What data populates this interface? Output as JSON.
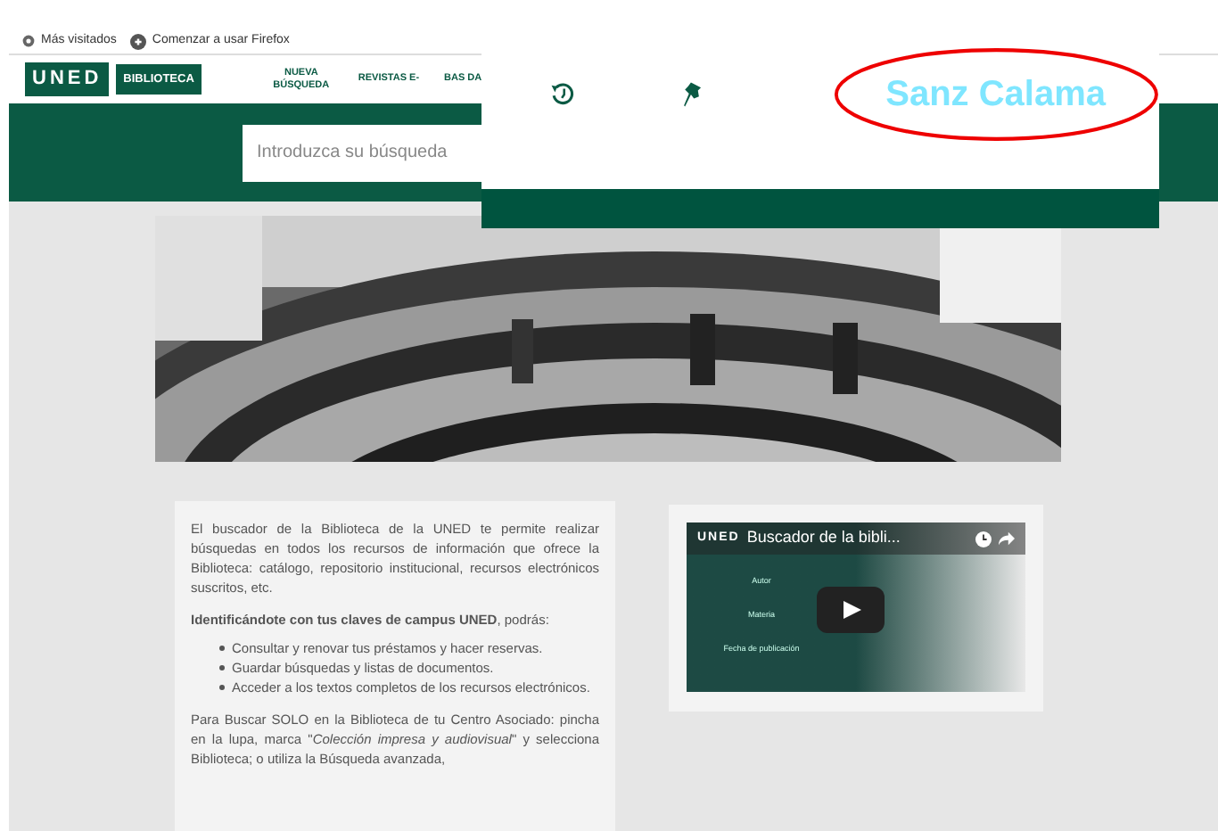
{
  "bookmarks": [
    {
      "label": "Más visitados",
      "kind": "gear"
    },
    {
      "label": "Comenzar a usar Firefox",
      "kind": "firefox"
    }
  ],
  "header": {
    "logo_mark": "UNED",
    "logo_label": "BIBLIOTECA",
    "nav": [
      "NUEVA BÚSQUEDA",
      "REVISTAS E-",
      "BAS DA"
    ]
  },
  "search": {
    "placeholder": "Introduzca su búsqueda"
  },
  "zoom_panel": {
    "icons": [
      {
        "kind": "history"
      },
      {
        "kind": "pin"
      }
    ],
    "user_name": "Sanz Calama",
    "highlighted": true
  },
  "intro": {
    "paragraph": "El buscador de la Biblioteca de la UNED te permite realizar búsquedas en todos los recursos de información que ofrece la Biblioteca: catálogo, repositorio institucional, recursos electrónicos suscritos, etc.",
    "login_note": "**Identificándote con tus claves de campus UNED**, podrás:",
    "bullets": [
      "Consultar y renovar tus préstamos y hacer reservas.",
      "Guardar búsquedas y listas de documentos.",
      "Acceder a los textos completos de los recursos electrónicos."
    ],
    "centre_note": "Para Buscar SOLO en la Biblioteca de tu Centro Asociado: pincha en la lupa, marca \"*Colección impresa y audiovisual*\" y selecciona Biblioteca; o utiliza la Búsqueda avanzada,"
  },
  "video": {
    "logo": "UNED",
    "title": "Buscador de la bibli...",
    "menu": [
      "Autor",
      "Materia",
      "Fecha de publicación"
    ]
  }
}
